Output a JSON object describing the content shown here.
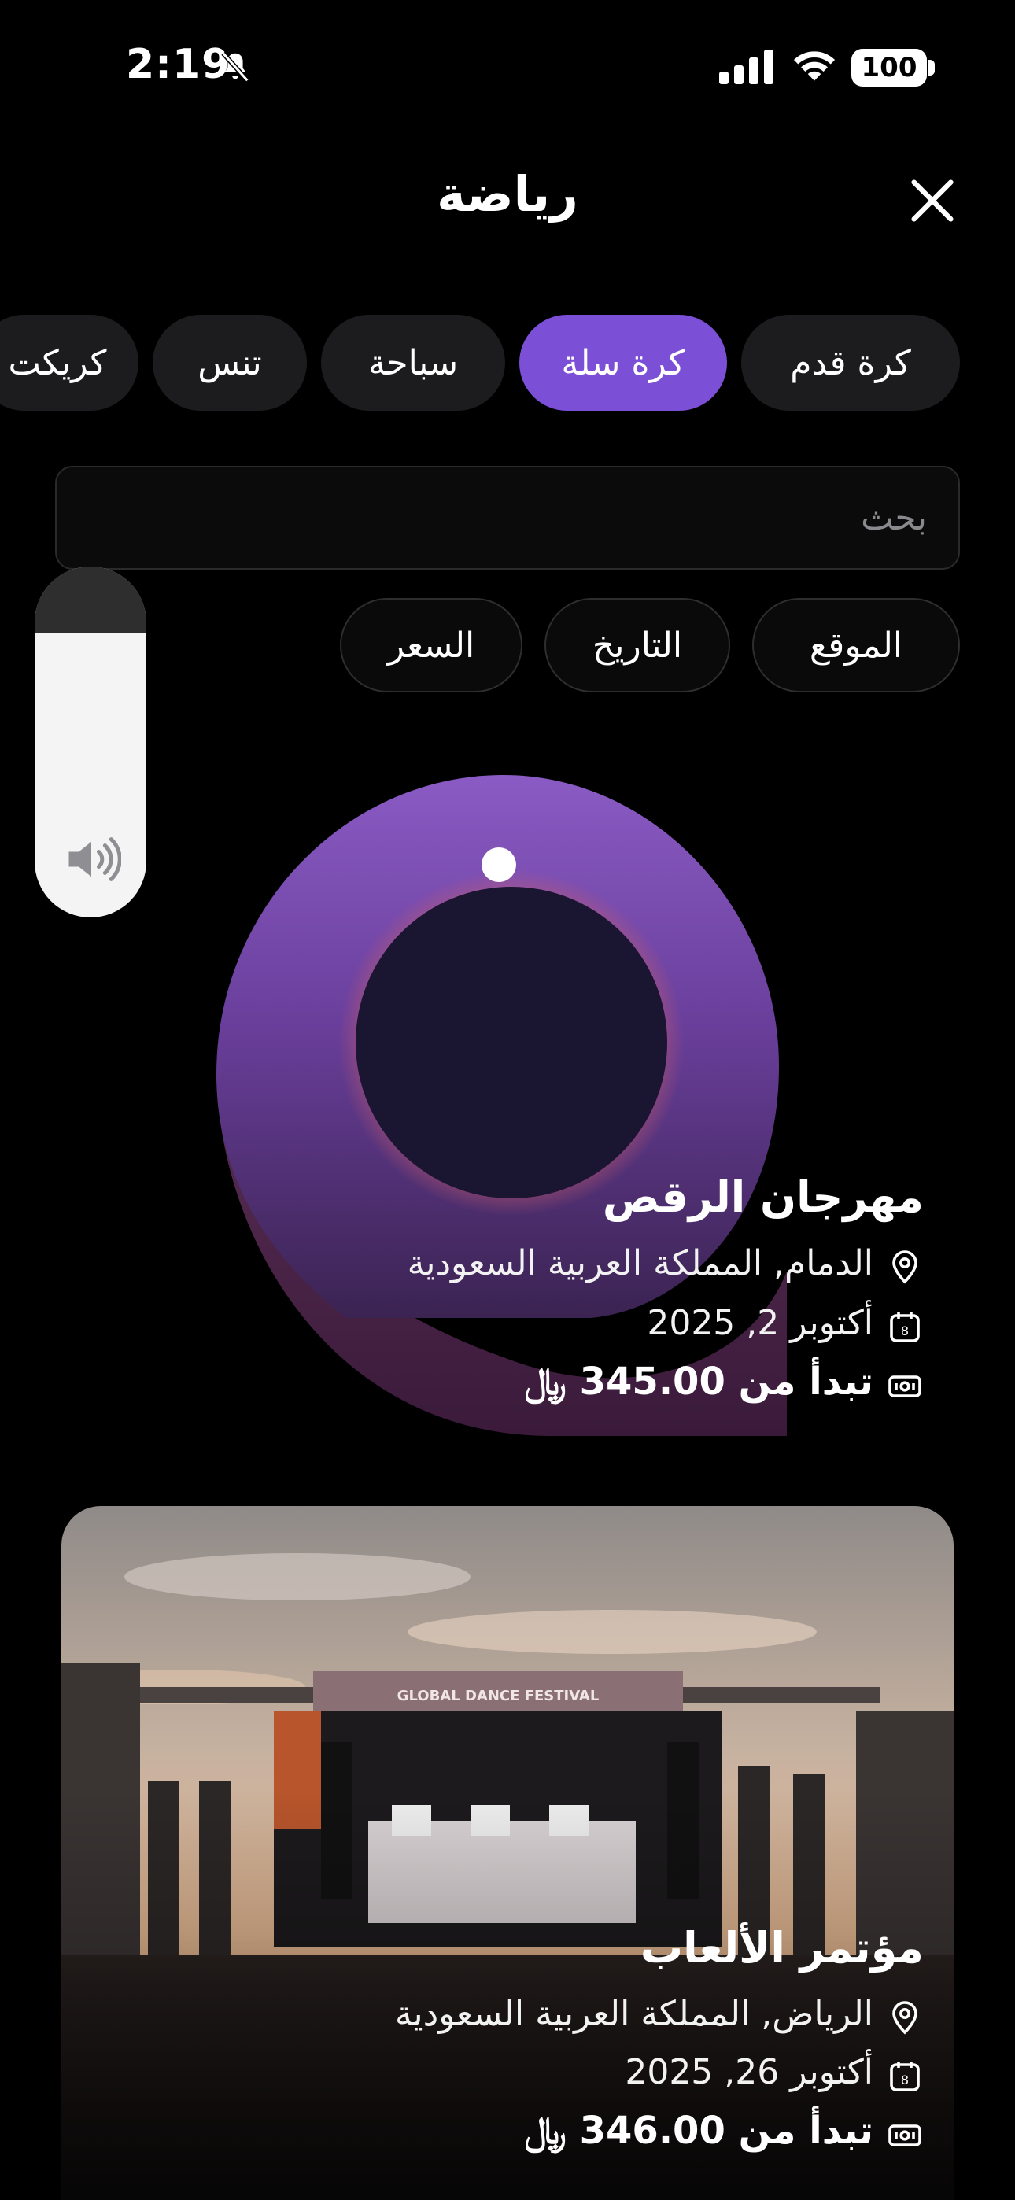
{
  "status_bar": {
    "time": "2:19",
    "battery": "100"
  },
  "header": {
    "title": "رياضة"
  },
  "categories": [
    {
      "label": "كرة قدم"
    },
    {
      "label": "كرة سلة"
    },
    {
      "label": "سباحة"
    },
    {
      "label": "تنس"
    },
    {
      "label": "كريكت"
    }
  ],
  "active_category": "كرة سلة",
  "search": {
    "placeholder": "بحث"
  },
  "filters": [
    {
      "label": "الموقع"
    },
    {
      "label": "التاريخ"
    },
    {
      "label": "السعر"
    }
  ],
  "events": [
    {
      "title": "مهرجان الرقص",
      "location": "الدمام, المملكة العربية السعودية",
      "date": "أكتوبر 2, 2025",
      "price": "تبدأ من 345.00 ﷼"
    },
    {
      "title": "مؤتمر الألعاب",
      "location": "الرياض, المملكة العربية السعودية",
      "date": "أكتوبر 26, 2025",
      "price": "تبدأ من 346.00 ﷼",
      "image_banner": "GLOBAL DANCE FESTIVAL"
    }
  ],
  "colors": {
    "accent": "#7b4fd6",
    "background": "#000000",
    "chip": "#1c1c1e"
  }
}
